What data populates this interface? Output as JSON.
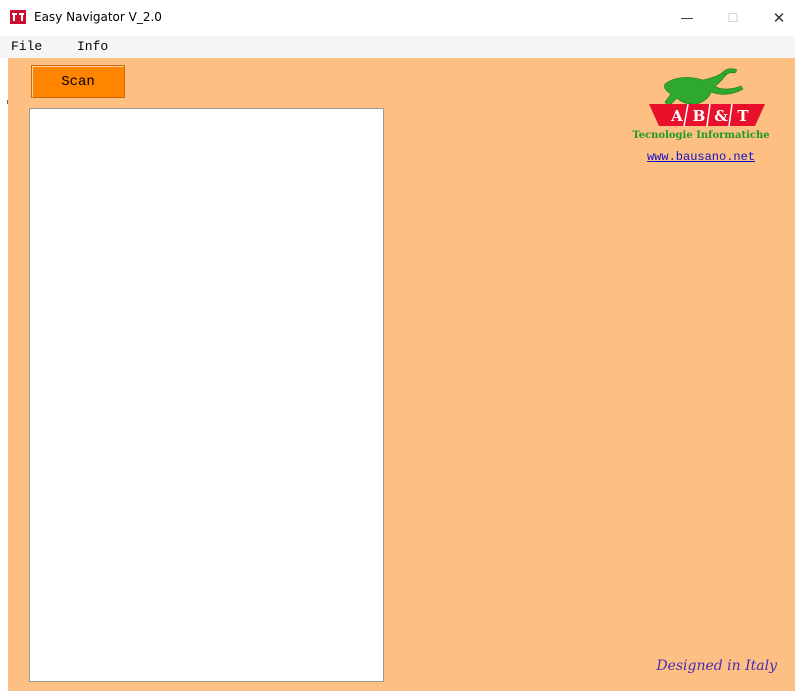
{
  "window": {
    "title": "Easy Navigator V_2.0",
    "controls": {
      "minimize": "—",
      "maximize": "☐",
      "close": "✕"
    }
  },
  "menu": {
    "items": [
      {
        "label": "File"
      },
      {
        "label": "Info"
      }
    ]
  },
  "toolbar": {
    "scan_label": "Scan"
  },
  "logo": {
    "icon": "horse-logo",
    "letters": [
      "A",
      "B",
      "&",
      "T"
    ],
    "subtitle": "Tecnologie Informatiche",
    "link": "www.bausano.net"
  },
  "footer": {
    "text": "Designed in Italy"
  },
  "colors": {
    "background": "#fdc082",
    "button": "#ff8400",
    "logo_red": "#e8102a",
    "logo_green": "#1e9a1e",
    "link": "#1010c8",
    "footer": "#4a2bb3"
  }
}
